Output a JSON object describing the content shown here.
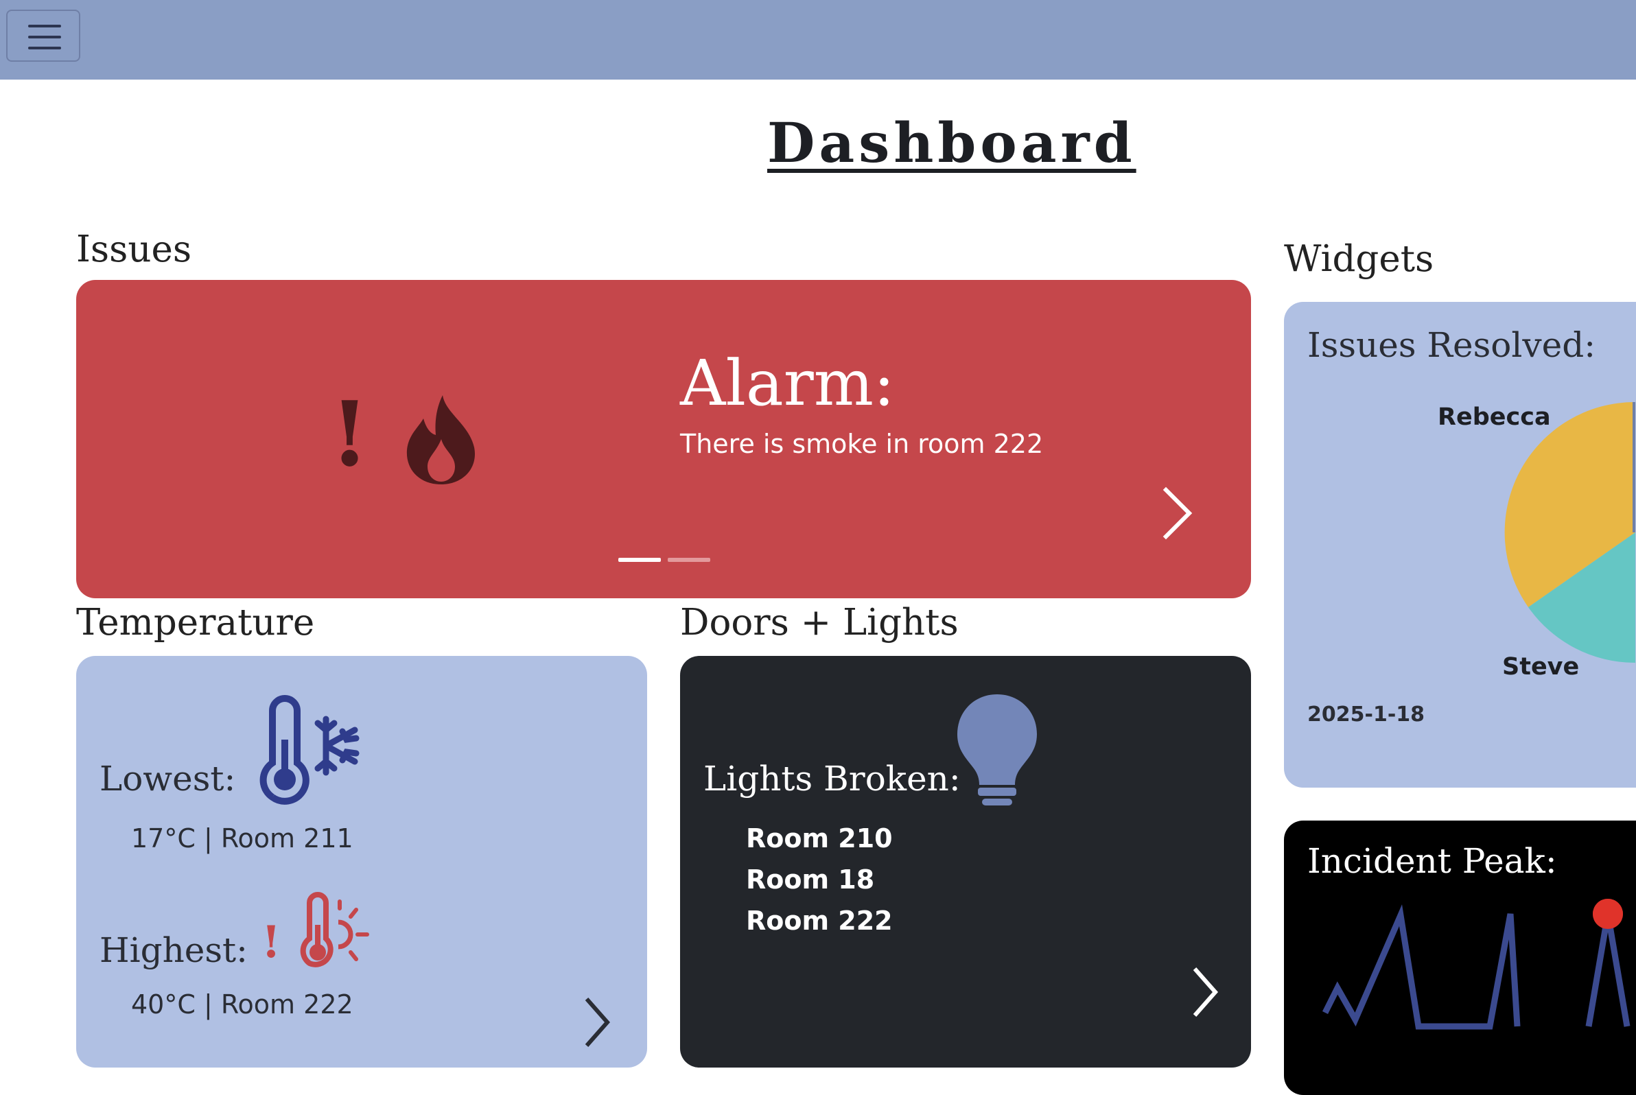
{
  "page": {
    "title": "Dashboard"
  },
  "sections": {
    "issues": "Issues",
    "widgets": "Widgets",
    "temperature": "Temperature",
    "doors_lights": "Doors + Lights"
  },
  "alarm": {
    "mark": "!",
    "icon": "fire-icon",
    "title": "Alarm:",
    "message": "There is smoke in room 222",
    "slides": 2,
    "active_slide": 1
  },
  "temperature": {
    "lowest_label": "Lowest:",
    "lowest_value": "17°C | Room 211",
    "lowest_icon": "thermometer-snowflake-icon",
    "highest_label": "Highest:",
    "highest_value": "40°C | Room 222",
    "highest_mark": "!",
    "highest_icon": "thermometer-sun-icon"
  },
  "lights": {
    "label": "Lights Broken:",
    "icon": "lightbulb-icon",
    "rooms": [
      "Room 210",
      "Room 18",
      "Room 222"
    ]
  },
  "issues_resolved": {
    "title": "Issues Resolved:",
    "date": "2025-1-18",
    "chart_data": {
      "type": "pie",
      "title": "",
      "series": [
        {
          "name": "Rebecca",
          "color": "#e8b745"
        },
        {
          "name": "Steve",
          "color": "#65c6c4"
        }
      ]
    }
  },
  "incident_peak": {
    "title": "Incident Peak:",
    "chart_data": {
      "type": "line",
      "title": "",
      "series_color": "#3b4a8f",
      "peak_marker_color": "#e0332a"
    }
  },
  "colors": {
    "topbar": "#8a9ec5",
    "alarm_bg": "#c5474b",
    "card_light": "#b0c0e3",
    "card_dark": "#23262b",
    "icon_blue": "#2f3c8c",
    "icon_red": "#c5474b",
    "bulb": "#7386b8"
  }
}
